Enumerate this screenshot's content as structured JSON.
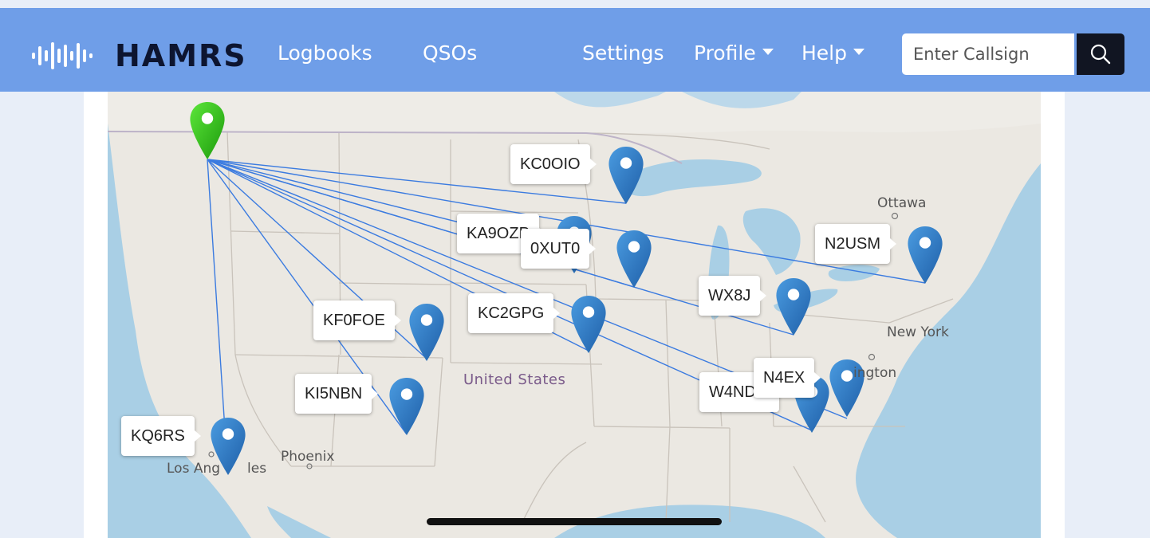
{
  "navbar": {
    "brand": "HAMRS",
    "links": [
      {
        "label": "Logbooks"
      },
      {
        "label": "QSOs"
      },
      {
        "label": "Settings"
      },
      {
        "label": "Profile"
      },
      {
        "label": "Help"
      }
    ],
    "search": {
      "placeholder": "Enter Callsign",
      "value": ""
    },
    "search_icon": "search-icon",
    "color": "#6f9ee8"
  },
  "map": {
    "home_marker_color": "#2ecc1a",
    "contact_marker_color": "#2f7fc8",
    "line_color": "#3b7be0",
    "contacts": [
      {
        "callsign": "KC0OIO"
      },
      {
        "callsign": "KA9OZP"
      },
      {
        "callsign": "0XUT0"
      },
      {
        "callsign": "N2USM"
      },
      {
        "callsign": "WX8J"
      },
      {
        "callsign": "KF0FOE"
      },
      {
        "callsign": "KC2GPG"
      },
      {
        "callsign": "N4EX"
      },
      {
        "callsign": "W4ND"
      },
      {
        "callsign": "KI5NBN"
      },
      {
        "callsign": "KQ6RS"
      }
    ],
    "places": {
      "ottawa": "Ottawa",
      "new_york": "New York",
      "washington": "ington",
      "united_states": "United States",
      "phoenix": "Phoenix",
      "los_angeles": "Los Ang",
      "los_angeles_end": "les"
    }
  }
}
